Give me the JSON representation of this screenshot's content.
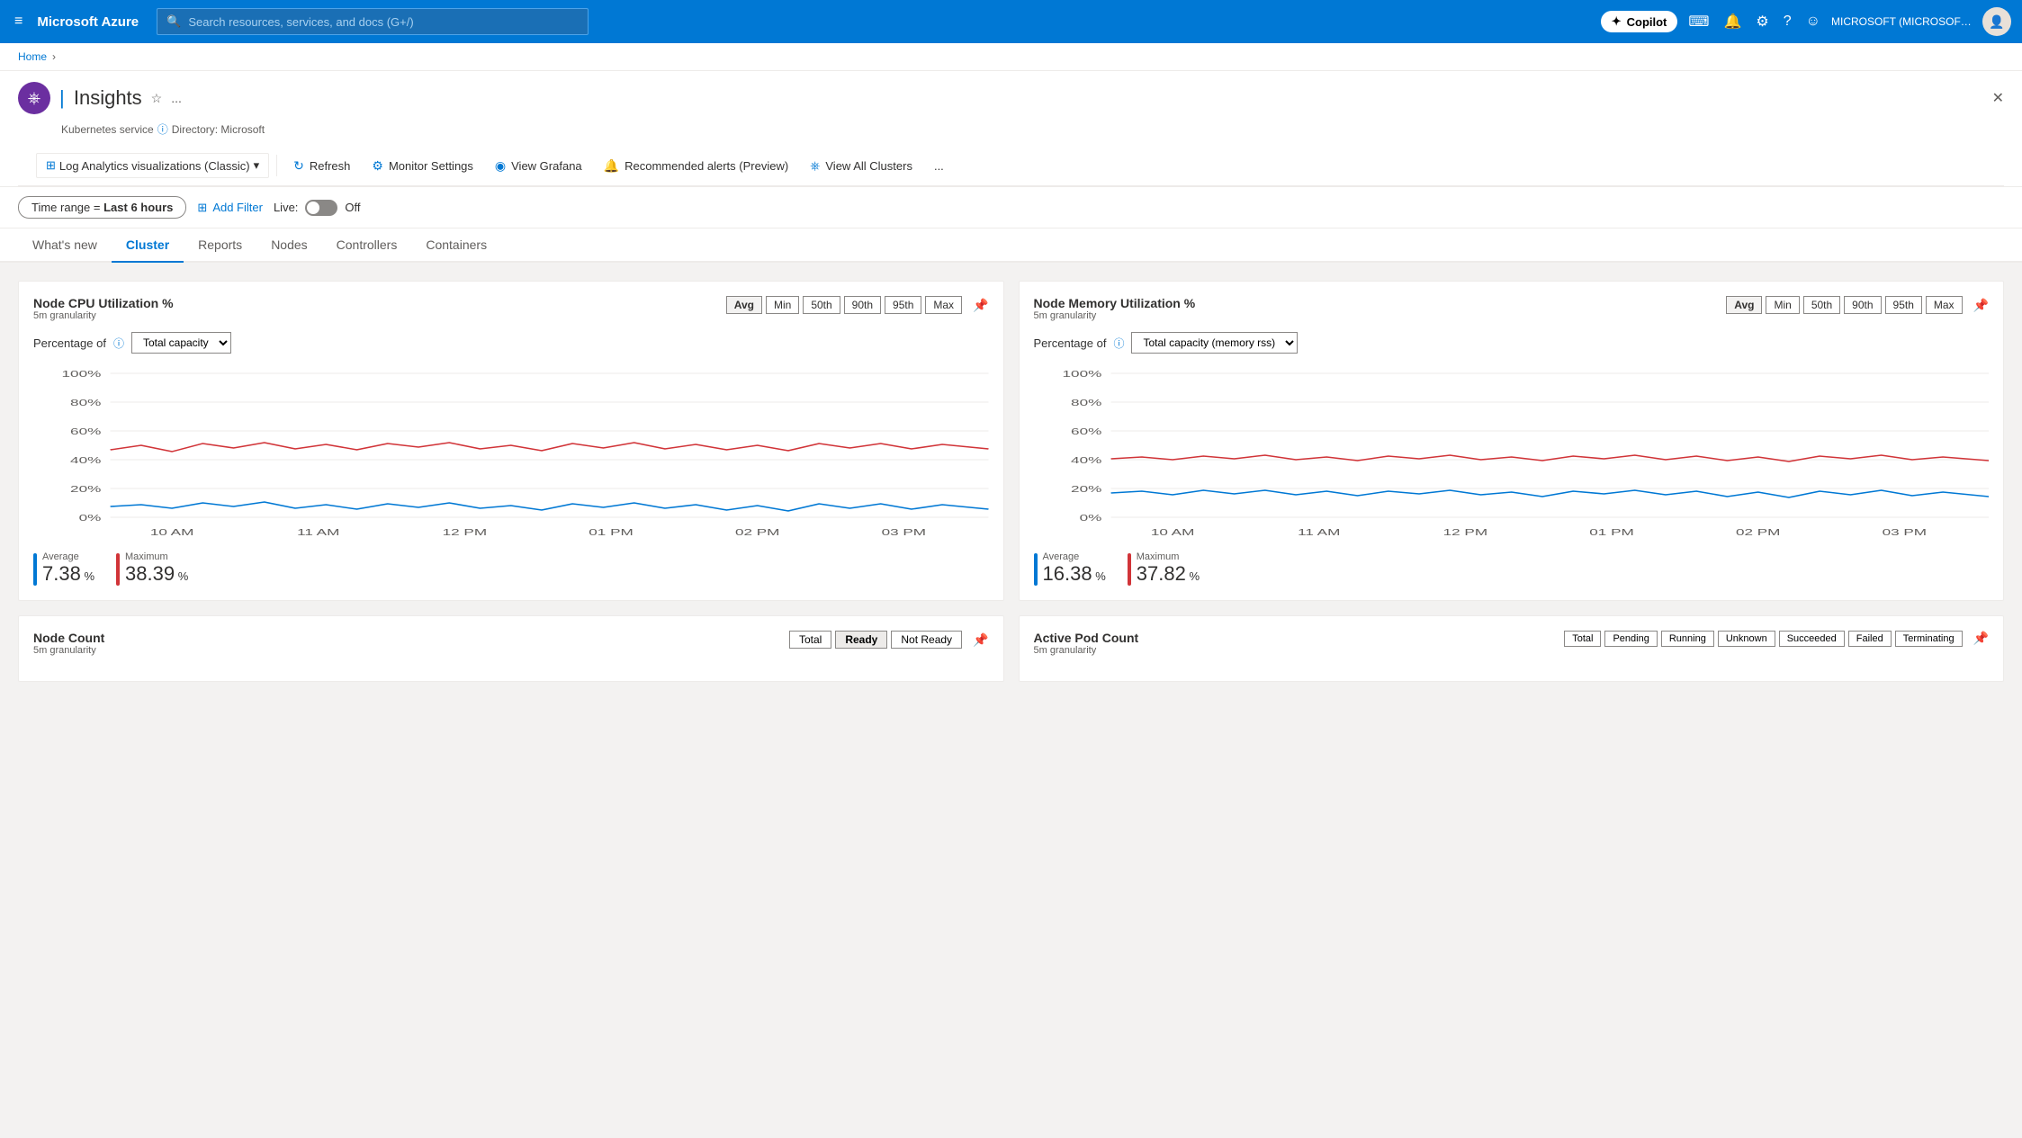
{
  "topnav": {
    "hamburger": "≡",
    "logo": "Microsoft Azure",
    "search_placeholder": "Search resources, services, and docs (G+/)",
    "copilot_label": "Copilot",
    "account_label": "MICROSOFT (MICROSOFT.ONMI...",
    "avatar_label": "👤"
  },
  "breadcrumb": {
    "home": "Home",
    "separator": "›"
  },
  "page": {
    "icon": "⎈",
    "title": "Insights",
    "service_label": "Kubernetes service",
    "directory_label": "Directory: Microsoft"
  },
  "toolbar": {
    "nav_dropdown_label": "Log Analytics visualizations (Classic)",
    "refresh_label": "Refresh",
    "monitor_settings_label": "Monitor Settings",
    "view_grafana_label": "View Grafana",
    "recommended_alerts_label": "Recommended alerts (Preview)",
    "view_all_clusters_label": "View All Clusters",
    "more_label": "..."
  },
  "filters": {
    "time_range_label": "Time range =",
    "time_range_value": "Last 6 hours",
    "add_filter_label": "Add Filter",
    "live_label": "Live:",
    "live_status": "Off"
  },
  "tabs": [
    {
      "id": "whats-new",
      "label": "What's new"
    },
    {
      "id": "cluster",
      "label": "Cluster",
      "active": true
    },
    {
      "id": "reports",
      "label": "Reports"
    },
    {
      "id": "nodes",
      "label": "Nodes"
    },
    {
      "id": "controllers",
      "label": "Controllers"
    },
    {
      "id": "containers",
      "label": "Containers"
    }
  ],
  "cpu_chart": {
    "title": "Node CPU Utilization %",
    "subtitle": "5m granularity",
    "stat_buttons": [
      "Avg",
      "Min",
      "50th",
      "90th",
      "95th",
      "Max"
    ],
    "active_btn": "Avg",
    "percentage_of_label": "Percentage of",
    "dropdown_label": "Total capacity",
    "y_labels": [
      "100%",
      "80%",
      "60%",
      "40%",
      "20%",
      "0%"
    ],
    "x_labels": [
      "10 AM",
      "11 AM",
      "12 PM",
      "01 PM",
      "02 PM",
      "03 PM"
    ],
    "avg_label": "Average",
    "avg_value": "7.38",
    "avg_unit": "%",
    "max_label": "Maximum",
    "max_value": "38.39",
    "max_unit": "%"
  },
  "memory_chart": {
    "title": "Node Memory Utilization %",
    "subtitle": "5m granularity",
    "stat_buttons": [
      "Avg",
      "Min",
      "50th",
      "90th",
      "95th",
      "Max"
    ],
    "active_btn": "Avg",
    "percentage_of_label": "Percentage of",
    "dropdown_label": "Total capacity (memory rss)",
    "y_labels": [
      "100%",
      "80%",
      "60%",
      "40%",
      "20%",
      "0%"
    ],
    "x_labels": [
      "10 AM",
      "11 AM",
      "12 PM",
      "01 PM",
      "02 PM",
      "03 PM"
    ],
    "avg_label": "Average",
    "avg_value": "16.38",
    "avg_unit": "%",
    "max_label": "Maximum",
    "max_value": "37.82",
    "max_unit": "%"
  },
  "node_count": {
    "title": "Node Count",
    "subtitle": "5m granularity",
    "buttons": [
      "Total",
      "Ready",
      "Not Ready"
    ]
  },
  "pod_count": {
    "title": "Active Pod Count",
    "subtitle": "5m granularity",
    "buttons": [
      "Total",
      "Pending",
      "Running",
      "Unknown",
      "Succeeded",
      "Failed",
      "Terminating"
    ]
  }
}
